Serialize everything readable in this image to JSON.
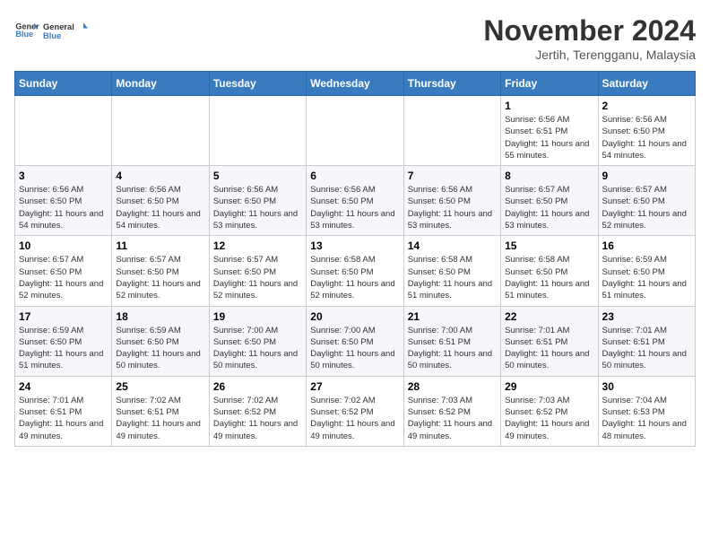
{
  "header": {
    "logo_line1": "General",
    "logo_line2": "Blue",
    "month": "November 2024",
    "location": "Jertih, Terengganu, Malaysia"
  },
  "weekdays": [
    "Sunday",
    "Monday",
    "Tuesday",
    "Wednesday",
    "Thursday",
    "Friday",
    "Saturday"
  ],
  "weeks": [
    [
      {
        "day": "",
        "info": ""
      },
      {
        "day": "",
        "info": ""
      },
      {
        "day": "",
        "info": ""
      },
      {
        "day": "",
        "info": ""
      },
      {
        "day": "",
        "info": ""
      },
      {
        "day": "1",
        "info": "Sunrise: 6:56 AM\nSunset: 6:51 PM\nDaylight: 11 hours and 55 minutes."
      },
      {
        "day": "2",
        "info": "Sunrise: 6:56 AM\nSunset: 6:50 PM\nDaylight: 11 hours and 54 minutes."
      }
    ],
    [
      {
        "day": "3",
        "info": "Sunrise: 6:56 AM\nSunset: 6:50 PM\nDaylight: 11 hours and 54 minutes."
      },
      {
        "day": "4",
        "info": "Sunrise: 6:56 AM\nSunset: 6:50 PM\nDaylight: 11 hours and 54 minutes."
      },
      {
        "day": "5",
        "info": "Sunrise: 6:56 AM\nSunset: 6:50 PM\nDaylight: 11 hours and 53 minutes."
      },
      {
        "day": "6",
        "info": "Sunrise: 6:56 AM\nSunset: 6:50 PM\nDaylight: 11 hours and 53 minutes."
      },
      {
        "day": "7",
        "info": "Sunrise: 6:56 AM\nSunset: 6:50 PM\nDaylight: 11 hours and 53 minutes."
      },
      {
        "day": "8",
        "info": "Sunrise: 6:57 AM\nSunset: 6:50 PM\nDaylight: 11 hours and 53 minutes."
      },
      {
        "day": "9",
        "info": "Sunrise: 6:57 AM\nSunset: 6:50 PM\nDaylight: 11 hours and 52 minutes."
      }
    ],
    [
      {
        "day": "10",
        "info": "Sunrise: 6:57 AM\nSunset: 6:50 PM\nDaylight: 11 hours and 52 minutes."
      },
      {
        "day": "11",
        "info": "Sunrise: 6:57 AM\nSunset: 6:50 PM\nDaylight: 11 hours and 52 minutes."
      },
      {
        "day": "12",
        "info": "Sunrise: 6:57 AM\nSunset: 6:50 PM\nDaylight: 11 hours and 52 minutes."
      },
      {
        "day": "13",
        "info": "Sunrise: 6:58 AM\nSunset: 6:50 PM\nDaylight: 11 hours and 52 minutes."
      },
      {
        "day": "14",
        "info": "Sunrise: 6:58 AM\nSunset: 6:50 PM\nDaylight: 11 hours and 51 minutes."
      },
      {
        "day": "15",
        "info": "Sunrise: 6:58 AM\nSunset: 6:50 PM\nDaylight: 11 hours and 51 minutes."
      },
      {
        "day": "16",
        "info": "Sunrise: 6:59 AM\nSunset: 6:50 PM\nDaylight: 11 hours and 51 minutes."
      }
    ],
    [
      {
        "day": "17",
        "info": "Sunrise: 6:59 AM\nSunset: 6:50 PM\nDaylight: 11 hours and 51 minutes."
      },
      {
        "day": "18",
        "info": "Sunrise: 6:59 AM\nSunset: 6:50 PM\nDaylight: 11 hours and 50 minutes."
      },
      {
        "day": "19",
        "info": "Sunrise: 7:00 AM\nSunset: 6:50 PM\nDaylight: 11 hours and 50 minutes."
      },
      {
        "day": "20",
        "info": "Sunrise: 7:00 AM\nSunset: 6:50 PM\nDaylight: 11 hours and 50 minutes."
      },
      {
        "day": "21",
        "info": "Sunrise: 7:00 AM\nSunset: 6:51 PM\nDaylight: 11 hours and 50 minutes."
      },
      {
        "day": "22",
        "info": "Sunrise: 7:01 AM\nSunset: 6:51 PM\nDaylight: 11 hours and 50 minutes."
      },
      {
        "day": "23",
        "info": "Sunrise: 7:01 AM\nSunset: 6:51 PM\nDaylight: 11 hours and 50 minutes."
      }
    ],
    [
      {
        "day": "24",
        "info": "Sunrise: 7:01 AM\nSunset: 6:51 PM\nDaylight: 11 hours and 49 minutes."
      },
      {
        "day": "25",
        "info": "Sunrise: 7:02 AM\nSunset: 6:51 PM\nDaylight: 11 hours and 49 minutes."
      },
      {
        "day": "26",
        "info": "Sunrise: 7:02 AM\nSunset: 6:52 PM\nDaylight: 11 hours and 49 minutes."
      },
      {
        "day": "27",
        "info": "Sunrise: 7:02 AM\nSunset: 6:52 PM\nDaylight: 11 hours and 49 minutes."
      },
      {
        "day": "28",
        "info": "Sunrise: 7:03 AM\nSunset: 6:52 PM\nDaylight: 11 hours and 49 minutes."
      },
      {
        "day": "29",
        "info": "Sunrise: 7:03 AM\nSunset: 6:52 PM\nDaylight: 11 hours and 49 minutes."
      },
      {
        "day": "30",
        "info": "Sunrise: 7:04 AM\nSunset: 6:53 PM\nDaylight: 11 hours and 48 minutes."
      }
    ]
  ]
}
